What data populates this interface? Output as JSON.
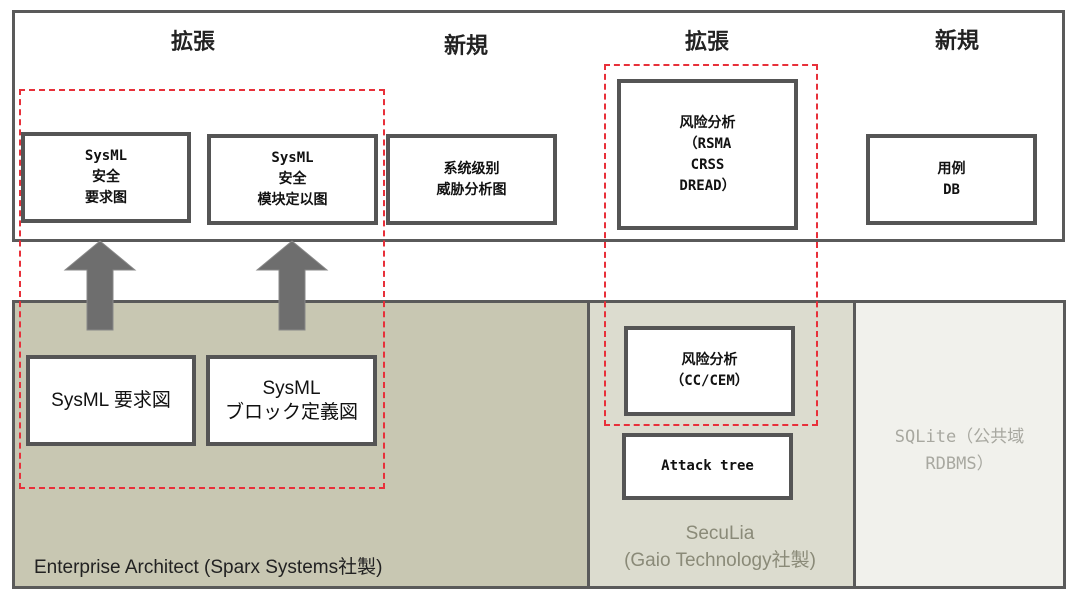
{
  "headers": [
    "拡張",
    "新規",
    "拡張",
    "新規"
  ],
  "top_boxes": [
    {
      "lines": [
        "SysML",
        "安全",
        "要求图"
      ]
    },
    {
      "lines": [
        "SysML",
        "安全",
        "模块定以图"
      ]
    },
    {
      "lines": [
        "系统级别",
        "威胁分析图"
      ]
    },
    {
      "lines": [
        "风险分析",
        "（RSMA",
        "CRSS",
        "DREAD）"
      ]
    },
    {
      "lines": [
        "用例",
        "DB"
      ]
    }
  ],
  "tools": {
    "ea": {
      "label": "Enterprise Architect (Sparx Systems社製)",
      "boxes": [
        {
          "lines": [
            "SysML 要求図"
          ]
        },
        {
          "lines": [
            "SysML",
            "ブロック定義図"
          ]
        }
      ],
      "color": "#c8c7b2"
    },
    "seculia": {
      "label_lines": [
        "SecuLia",
        "(Gaio Technology社製)"
      ],
      "boxes": [
        {
          "lines": [
            "风险分析",
            "（CC/CEM）"
          ]
        },
        {
          "lines": [
            "Attack tree"
          ]
        }
      ],
      "color": "#dcdccf"
    },
    "sqlite": {
      "label_lines": [
        "SQLite（公共域",
        "RDBMS）"
      ],
      "color": "#f1f1ec"
    }
  },
  "colors": {
    "highlight_dash": "#e8303a",
    "arrow": "#6e6e6e",
    "border": "#5a5a5a"
  }
}
